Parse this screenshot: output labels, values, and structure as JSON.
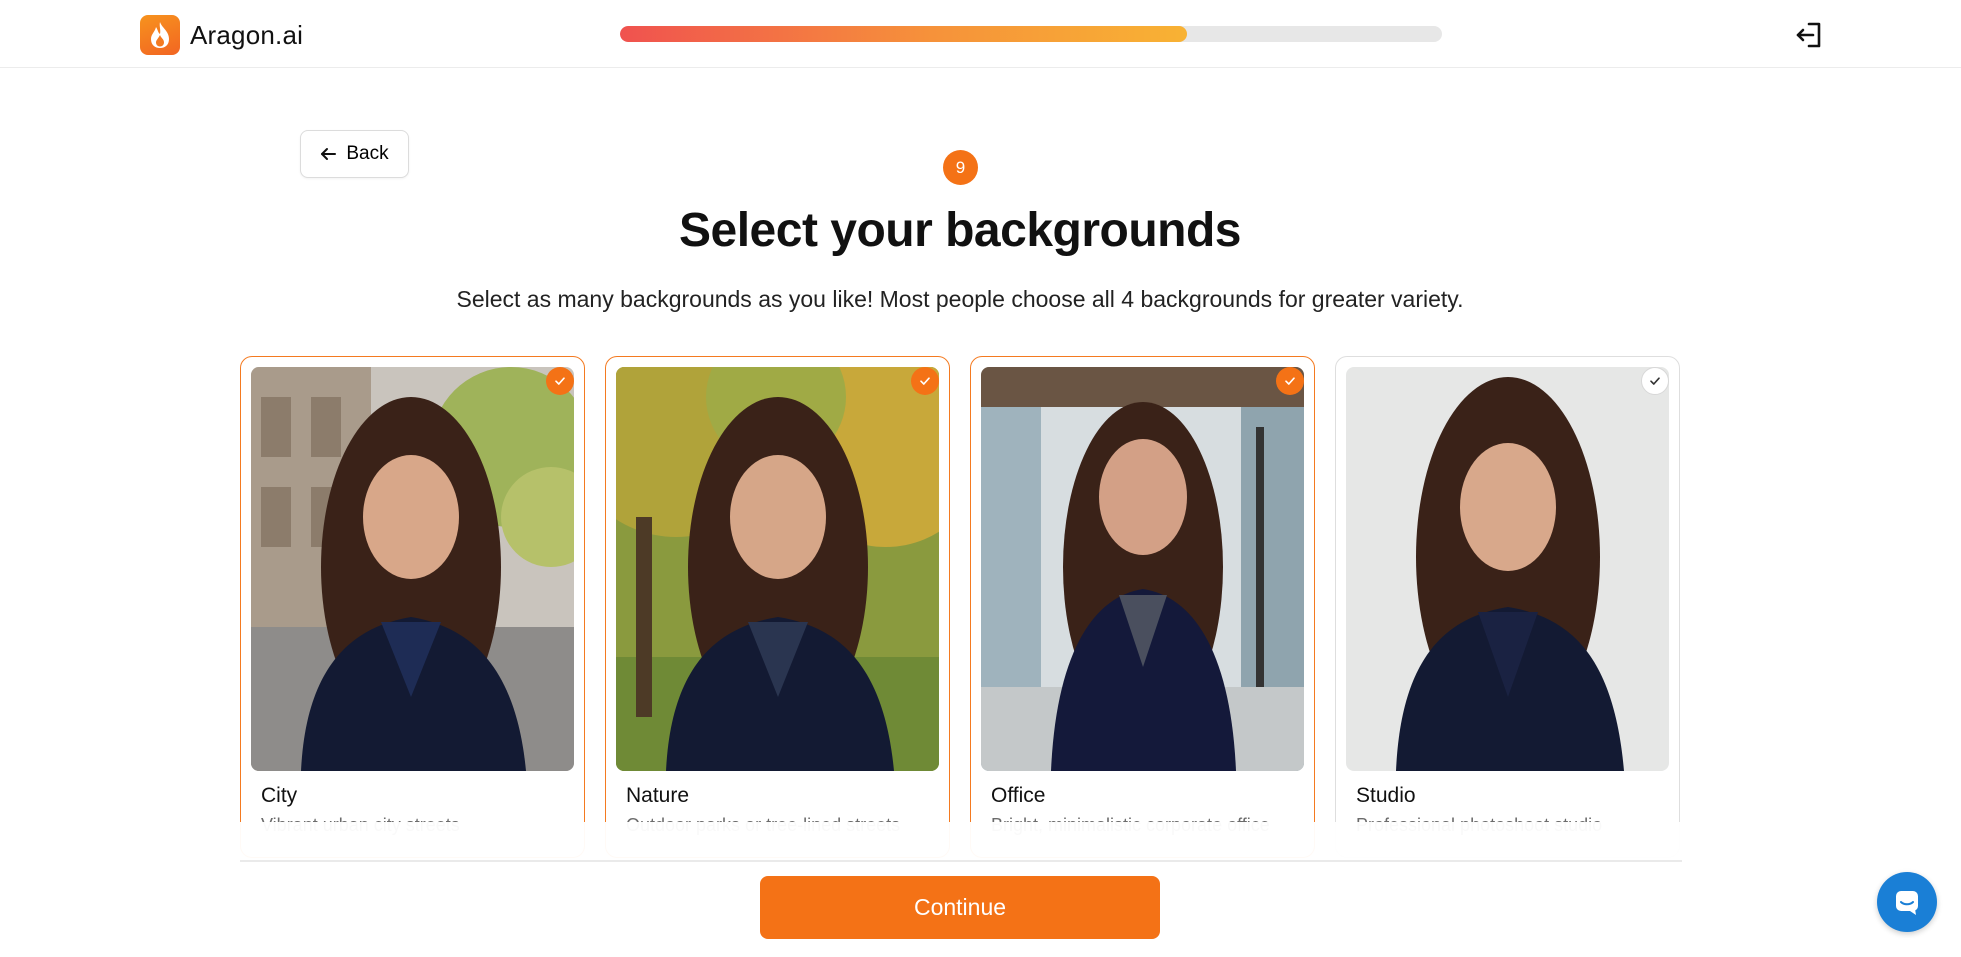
{
  "header": {
    "brand": "Aragon.ai",
    "logo_icon": "flame-icon",
    "progress_percent": 69,
    "logout_icon": "logout-icon"
  },
  "nav": {
    "back_label": "Back",
    "back_icon": "arrow-left-icon"
  },
  "step": {
    "number": "9"
  },
  "heading": {
    "title": "Select your backgrounds",
    "subtitle": "Select as many backgrounds as you like! Most people choose all 4 backgrounds for greater variety."
  },
  "backgrounds": [
    {
      "name": "City",
      "description": "Vibrant urban city streets",
      "selected": true
    },
    {
      "name": "Nature",
      "description": "Outdoor parks or tree-lined streets",
      "selected": true
    },
    {
      "name": "Office",
      "description": "Bright, minimalistic corporate office",
      "selected": true
    },
    {
      "name": "Studio",
      "description": "Professional photoshoot studio",
      "selected": false
    }
  ],
  "footer": {
    "continue_label": "Continue"
  },
  "colors": {
    "accent": "#f47216",
    "chat": "#1a7fd6"
  }
}
